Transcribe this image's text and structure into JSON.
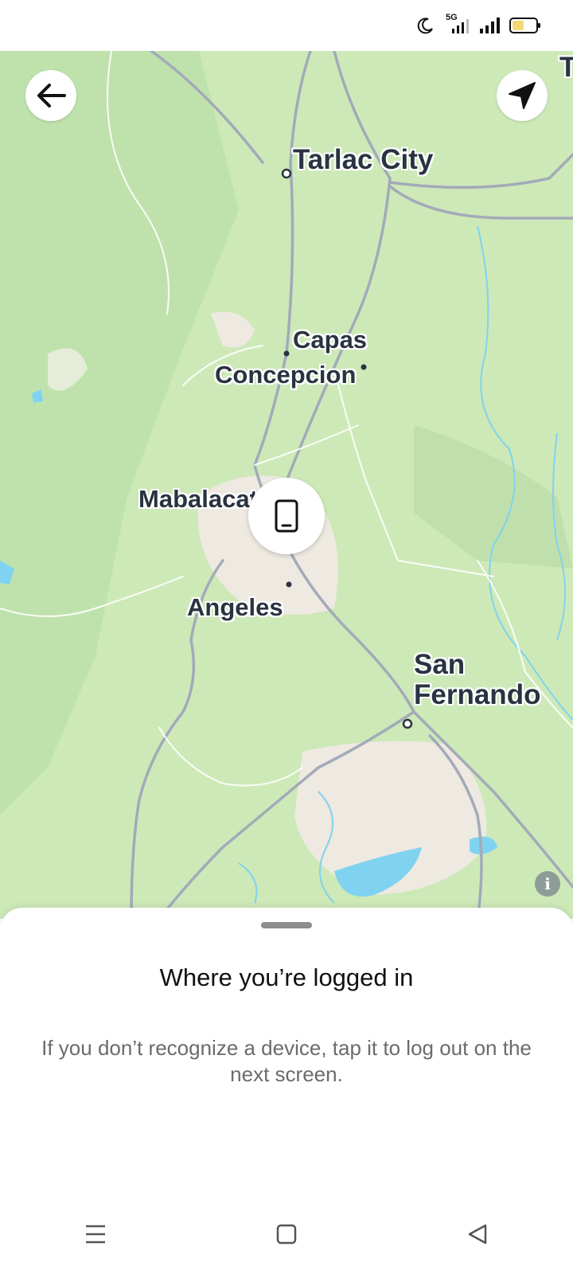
{
  "status_bar": {
    "icons": [
      "moon-icon",
      "5g-signal-icon",
      "signal-icon",
      "battery-icon"
    ],
    "network_label": "5G"
  },
  "map": {
    "cities": [
      {
        "name": "Tarlac City",
        "size": "big"
      },
      {
        "name": "Capas",
        "size": "normal"
      },
      {
        "name": "Concepcion",
        "size": "normal"
      },
      {
        "name": "Mabalacat",
        "size": "normal"
      },
      {
        "name": "Angeles",
        "size": "normal"
      },
      {
        "name": "San\nFernando",
        "size": "big"
      },
      {
        "name": "T",
        "size": "big"
      }
    ],
    "colors": {
      "land": "#cde9b8",
      "urban": "#efeae3",
      "water": "#7fd3f0",
      "road": "#a3aab8"
    }
  },
  "controls": {
    "back_icon": "arrow-left-icon",
    "locate_icon": "navigation-arrow-icon",
    "device_icon": "phone-icon",
    "info_label": "i"
  },
  "sheet": {
    "title": "Where you’re logged in",
    "description": "If you don’t recognize a device, tap it to log out on the next screen."
  },
  "nav_bar": {
    "icons": [
      "menu-icon",
      "home-square-icon",
      "back-triangle-icon"
    ]
  }
}
